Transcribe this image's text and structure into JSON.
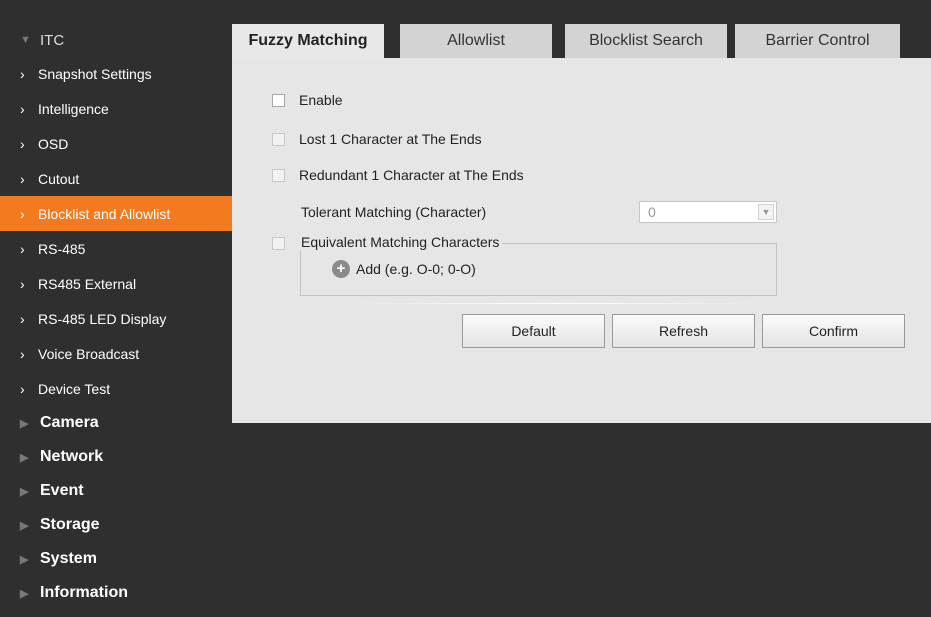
{
  "sidebar": {
    "itc_label": "ITC",
    "sub_items": [
      {
        "label": "Snapshot Settings",
        "active": false
      },
      {
        "label": "Intelligence",
        "active": false
      },
      {
        "label": "OSD",
        "active": false
      },
      {
        "label": "Cutout",
        "active": false
      },
      {
        "label": "Blocklist and Allowlist",
        "active": true
      },
      {
        "label": "RS-485",
        "active": false
      },
      {
        "label": "RS485 External",
        "active": false
      },
      {
        "label": "RS-485 LED Display",
        "active": false
      },
      {
        "label": "Voice Broadcast",
        "active": false
      },
      {
        "label": "Device Test",
        "active": false
      }
    ],
    "sections": [
      "Camera",
      "Network",
      "Event",
      "Storage",
      "System",
      "Information"
    ]
  },
  "tabs": [
    "Fuzzy Matching",
    "Allowlist",
    "Blocklist Search",
    "Barrier Control"
  ],
  "active_tab": "Fuzzy Matching",
  "form": {
    "enable_label": "Enable",
    "lost_label": "Lost 1 Character at The Ends",
    "redundant_label": "Redundant 1 Character at The Ends",
    "tolerant_label": "Tolerant Matching (Character)",
    "tolerant_value": "0",
    "equivalent_label": "Equivalent Matching Characters",
    "add_label": "Add (e.g. O-0; 0-O)"
  },
  "buttons": {
    "default_label": "Default",
    "refresh_label": "Refresh",
    "confirm_label": "Confirm"
  },
  "colors": {
    "accent": "#f47a20",
    "sidebar_bg": "#2f2f2f",
    "panel_bg": "#e6e6e6"
  }
}
